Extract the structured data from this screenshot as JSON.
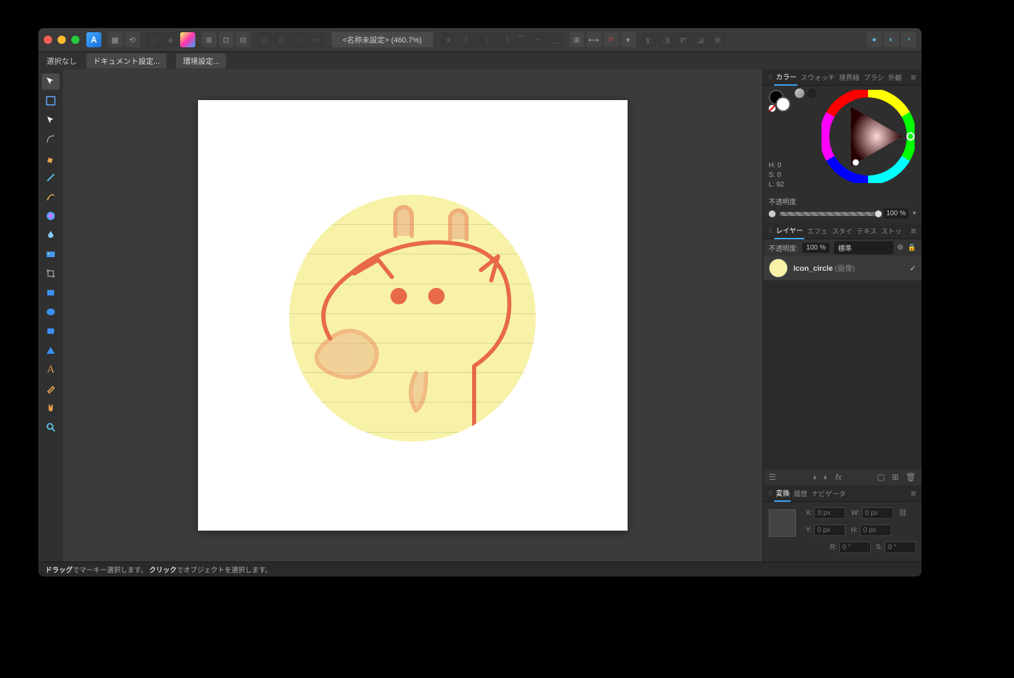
{
  "titlebar": {
    "doc_title": "<名称未設定> (460.7%)",
    "star": "★"
  },
  "context_bar": {
    "selection": "選択なし",
    "doc_settings": "ドキュメント設定...",
    "prefs": "環境設定..."
  },
  "color_panel": {
    "tabs": [
      "カラー",
      "スウォッチ",
      "境界線",
      "ブラシ",
      "外観"
    ],
    "h_label": "H: 0",
    "s_label": "S: 0",
    "l_label": "L: 92",
    "opacity_label": "不透明度",
    "opacity_value": "100 %"
  },
  "layers_panel": {
    "tabs": [
      "レイヤー",
      "エフェ",
      "スタイ",
      "テキス",
      "ストッ"
    ],
    "opacity_label": "不透明度:",
    "opacity_value": "100 %",
    "blend": "標準",
    "layer_name": "Icon_circle",
    "layer_type": "(画像)"
  },
  "transform_panel": {
    "tabs": [
      "変換",
      "履歴",
      "ナビゲータ"
    ],
    "x_label": "X:",
    "x_val": "0 px",
    "y_label": "Y:",
    "y_val": "0 px",
    "w_label": "W:",
    "w_val": "0 px",
    "h_label": "H:",
    "h_val": "0 px",
    "r_label": "R:",
    "r_val": "0 °",
    "s_label2": "S:",
    "s_val": "0 °"
  },
  "statusbar": {
    "drag_bold": "ドラッグ",
    "drag_rest": "でマーキー選択します。",
    "click_bold": "クリック",
    "click_rest": "でオブジェクトを選択します。"
  }
}
